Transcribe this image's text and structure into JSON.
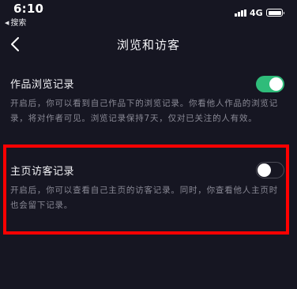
{
  "status_bar": {
    "time": "6:10",
    "back_app": "搜索",
    "network": "4G",
    "battery_icon": "battery-full-icon",
    "signal_icon": "signal-bars-icon"
  },
  "nav": {
    "title": "浏览和访客",
    "back_icon": "chevron-left-icon"
  },
  "settings": [
    {
      "title": "作品浏览记录",
      "description": "开启后，你可以看到自己作品下的浏览记录。你看他人作品的浏览记录，将对作者可见。浏览记录保持7天，仅对已关注的人有效。",
      "enabled": true
    },
    {
      "title": "主页访客记录",
      "description": "开启后，你可以查看自己主页的访客记录。同时，你查看他人主页时也会留下记录。",
      "enabled": false
    }
  ],
  "colors": {
    "background": "#161622",
    "toggle_on": "#2fbc7a",
    "highlight": "#ff0000",
    "description_text": "#8a8a96"
  }
}
